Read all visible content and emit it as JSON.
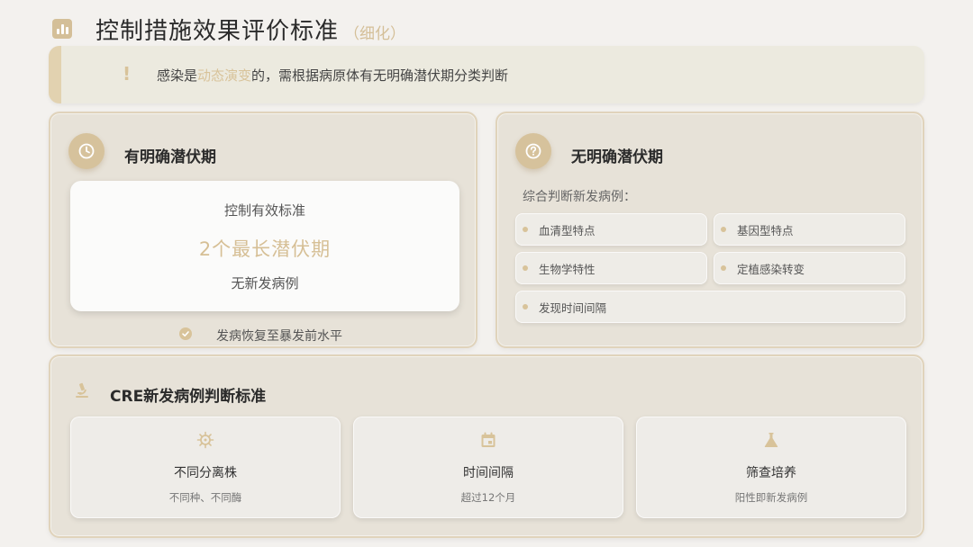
{
  "header": {
    "title": "控制措施效果评价标准",
    "subtitle": "（细化）",
    "icon": "bar-chart-icon"
  },
  "notice": {
    "mark": "!",
    "text_before": "感染是",
    "text_highlight": "动态演变",
    "text_after": "的，需根据病原体有无明确潜伏期分类判断"
  },
  "left_card": {
    "icon": "clock-icon",
    "title": "有明确潜伏期",
    "inner": {
      "label": "控制有效标准",
      "value": "2个最长潜伏期",
      "note": "无新发病例"
    },
    "check_text": "发病恢复至暴发前水平"
  },
  "right_card": {
    "icon": "question-icon",
    "title": "无明确潜伏期",
    "desc": "综合判断新发病例：",
    "tags": [
      "血清型特点",
      "基因型特点",
      "生物学特性",
      "定植感染转变",
      "发现时间间隔"
    ]
  },
  "bottom_card": {
    "icon": "microscope-icon",
    "title": "CRE新发病例判断标准",
    "items": [
      {
        "icon": "virus-icon",
        "title": "不同分离株",
        "sub": "不同种、不同酶"
      },
      {
        "icon": "calendar-icon",
        "title": "时间间隔",
        "sub": "超过12个月"
      },
      {
        "icon": "flask-icon",
        "title": "筛查培养",
        "sub": "阳性即新发病例"
      }
    ]
  },
  "colors": {
    "accent": "#d6c29c",
    "background": "#f3f1ee",
    "card": "#e7e2d8"
  }
}
